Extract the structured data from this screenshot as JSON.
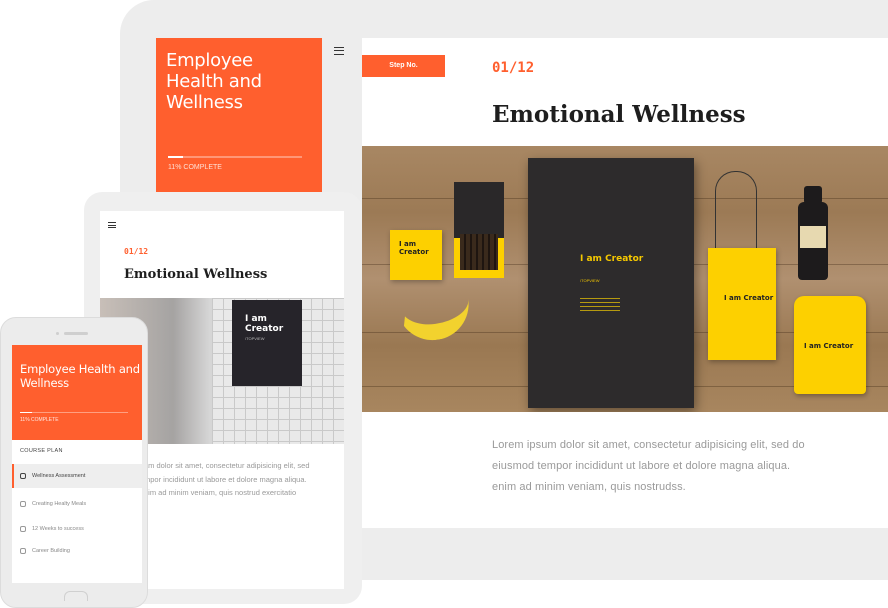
{
  "desktop": {
    "course_title": "Employee Health and Wellness",
    "progress_percent": 11,
    "progress_text": "11% COMPLETE",
    "step_label": "Step No.",
    "step_number": "01/12",
    "lesson_title": "Emotional Wellness",
    "body_lines": [
      "Lorem ipsum dolor sit amet, consectetur adipisicing elit, sed do",
      "eiusmod tempor incididunt ut labore et dolore magna aliqua.",
      "enim ad minim veniam, quis nostrudss."
    ],
    "image": {
      "folder_text": "I am Creator",
      "folder_sub": "/TOPVIEW",
      "card_text": "I am Creator",
      "bag_text": "I am Creator",
      "pouch_text": "I am Creator"
    }
  },
  "tablet": {
    "step_number": "01/12",
    "lesson_title": "Emotional Wellness",
    "poster_text": "I am Creator",
    "poster_sub": "/TOPVIEW",
    "body_lines": [
      "am dolor sit amet, consectetur adipisicing elit, sed",
      "mpor incididunt ut labore et dolore magna aliqua.",
      "nim ad minim veniam, quis nostrud exercitatio"
    ]
  },
  "phone": {
    "course_title": "Employee Health and Wellness",
    "progress_percent": 11,
    "progress_text": "11% COMPLETE",
    "plan_heading": "COURSE PLAN",
    "plan_items": [
      "Wellness Assessment",
      "Creating Healty Meals",
      "12 Weeks to success",
      "Career Building"
    ]
  },
  "colors": {
    "accent": "#ff5f2e",
    "yellow": "#fdd000",
    "dark": "#2d2b2c"
  }
}
